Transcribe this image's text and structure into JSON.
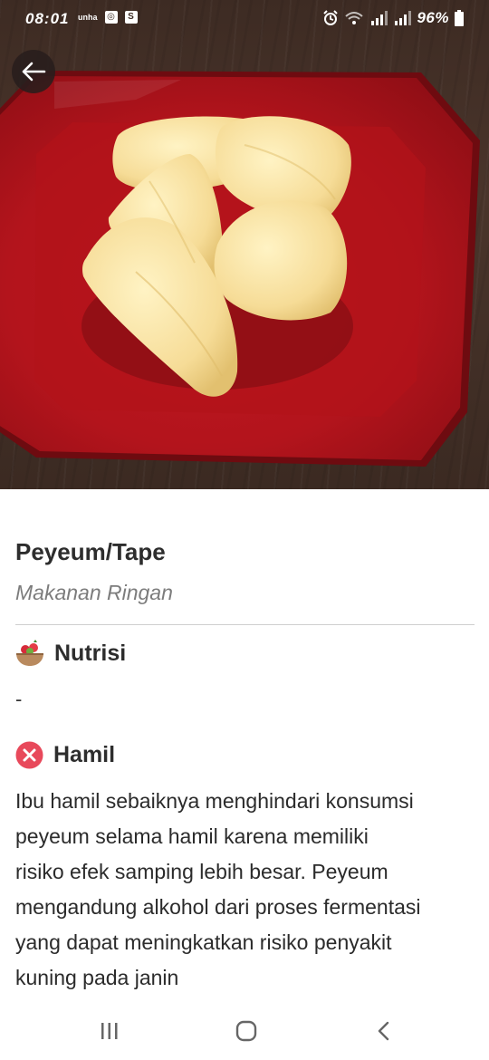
{
  "status_bar": {
    "time": "08:01",
    "notif_icons": [
      "uniline-icon",
      "instagram-icon",
      "s-app-icon"
    ],
    "notif_small_text": "unha",
    "right_icons": [
      "alarm-icon",
      "wifi-icon",
      "signal-icon",
      "signal-icon-2",
      "battery-icon"
    ],
    "battery": "96%"
  },
  "hero": {
    "image": "peyeum-on-red-plate",
    "back_icon": "arrow-left-icon"
  },
  "food": {
    "title": "Peyeum/Tape",
    "category": "Makanan Ringan"
  },
  "sections": {
    "nutrition": {
      "icon": "food-bowl-icon",
      "label": "Nutrisi",
      "value": "-"
    },
    "pregnant": {
      "icon": "cross-circle-icon",
      "label": "Hamil",
      "lines": [
        "Ibu hamil sebaiknya menghindari konsumsi",
        "peyeum selama hamil karena memiliki",
        "risiko efek samping lebih besar. Peyeum",
        "mengandung alkohol dari proses fermentasi",
        "yang dapat meningkatkan risiko penyakit",
        "kuning pada janin"
      ]
    }
  },
  "nav": {
    "icons": [
      "recent-apps-icon",
      "home-icon",
      "back-icon"
    ]
  },
  "colors": {
    "plate_red": "#b8141c",
    "danger_red": "#e8495b",
    "text_dark": "#2d2d2d",
    "text_muted": "#7c7c7c"
  }
}
